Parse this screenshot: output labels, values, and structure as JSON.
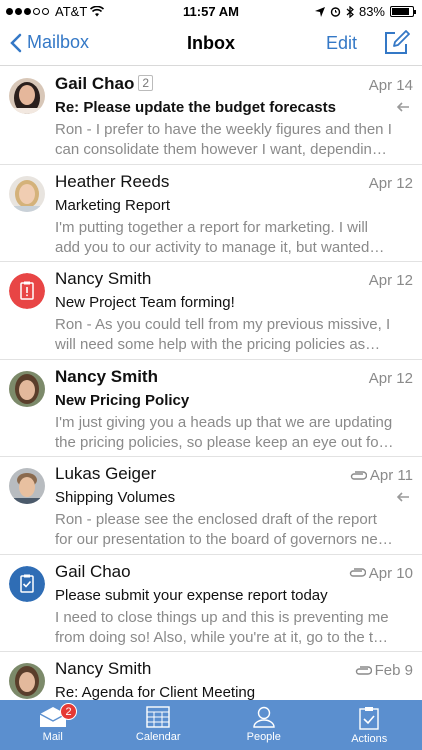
{
  "status_bar": {
    "carrier": "AT&T",
    "time": "11:57 AM",
    "battery": "83%",
    "battery_level": 0.83
  },
  "nav": {
    "back_label": "Mailbox",
    "title": "Inbox",
    "edit_label": "Edit"
  },
  "messages": [
    {
      "sender": "Gail Chao",
      "thread_count": "2",
      "date": "Apr 14",
      "subject": "Re: Please update the budget forecasts",
      "preview": "Ron - I prefer to have the weekly figures and then I can consolidate them however I want, dependin…",
      "unread": true,
      "replied": true,
      "attachment": false,
      "avatar": "photo-woman-dark-hair"
    },
    {
      "sender": "Heather Reeds",
      "date": "Apr 12",
      "subject": "Marketing Report",
      "preview": "I'm putting together a report for marketing. I will add you to our activity to manage it, but wanted…",
      "unread": false,
      "replied": false,
      "attachment": false,
      "avatar": "photo-woman-blonde"
    },
    {
      "sender": "Nancy Smith",
      "date": "Apr 12",
      "subject": "New Project Team forming!",
      "preview": "Ron - As you could tell from my previous missive, I will need some help with the pricing policies as…",
      "unread": false,
      "replied": false,
      "attachment": false,
      "avatar": "red-alert-clipboard-icon"
    },
    {
      "sender": "Nancy Smith",
      "date": "Apr 12",
      "subject": "New Pricing Policy",
      "preview": "I'm just giving you a heads up that we are updating the pricing policies, so please keep an eye out fo…",
      "unread": true,
      "replied": false,
      "attachment": false,
      "avatar": "photo-woman-brown-hair"
    },
    {
      "sender": "Lukas Geiger",
      "date": "Apr 11",
      "subject": "Shipping Volumes",
      "preview": "Ron - please see the enclosed draft of the report for our presentation to the board of governors ne…",
      "unread": false,
      "replied": true,
      "attachment": true,
      "avatar": "photo-man"
    },
    {
      "sender": "Gail Chao",
      "date": "Apr 10",
      "subject": "Please submit your expense report today",
      "preview": "I need to close things up and this is preventing me from doing so! Also, while you're at it, go to the t…",
      "unread": false,
      "replied": false,
      "attachment": true,
      "avatar": "blue-checklist-icon"
    },
    {
      "sender": "Nancy Smith",
      "date": "Feb 9",
      "subject": "Re: Agenda for Client Meeting",
      "preview": "",
      "unread": false,
      "replied": false,
      "attachment": true,
      "avatar": "photo-woman-brown-hair"
    }
  ],
  "tabs": [
    {
      "label": "Mail",
      "icon": "mail-icon",
      "badge": "2",
      "active": true
    },
    {
      "label": "Calendar",
      "icon": "calendar-icon",
      "active": false
    },
    {
      "label": "People",
      "icon": "person-icon",
      "active": false
    },
    {
      "label": "Actions",
      "icon": "clipboard-check-icon",
      "active": false
    }
  ],
  "colors": {
    "accent": "#3478c6",
    "tab_bar": "#5b8fcf",
    "badge": "#e53935",
    "alert_avatar": "#e84545",
    "checklist_avatar": "#2f6db5"
  }
}
